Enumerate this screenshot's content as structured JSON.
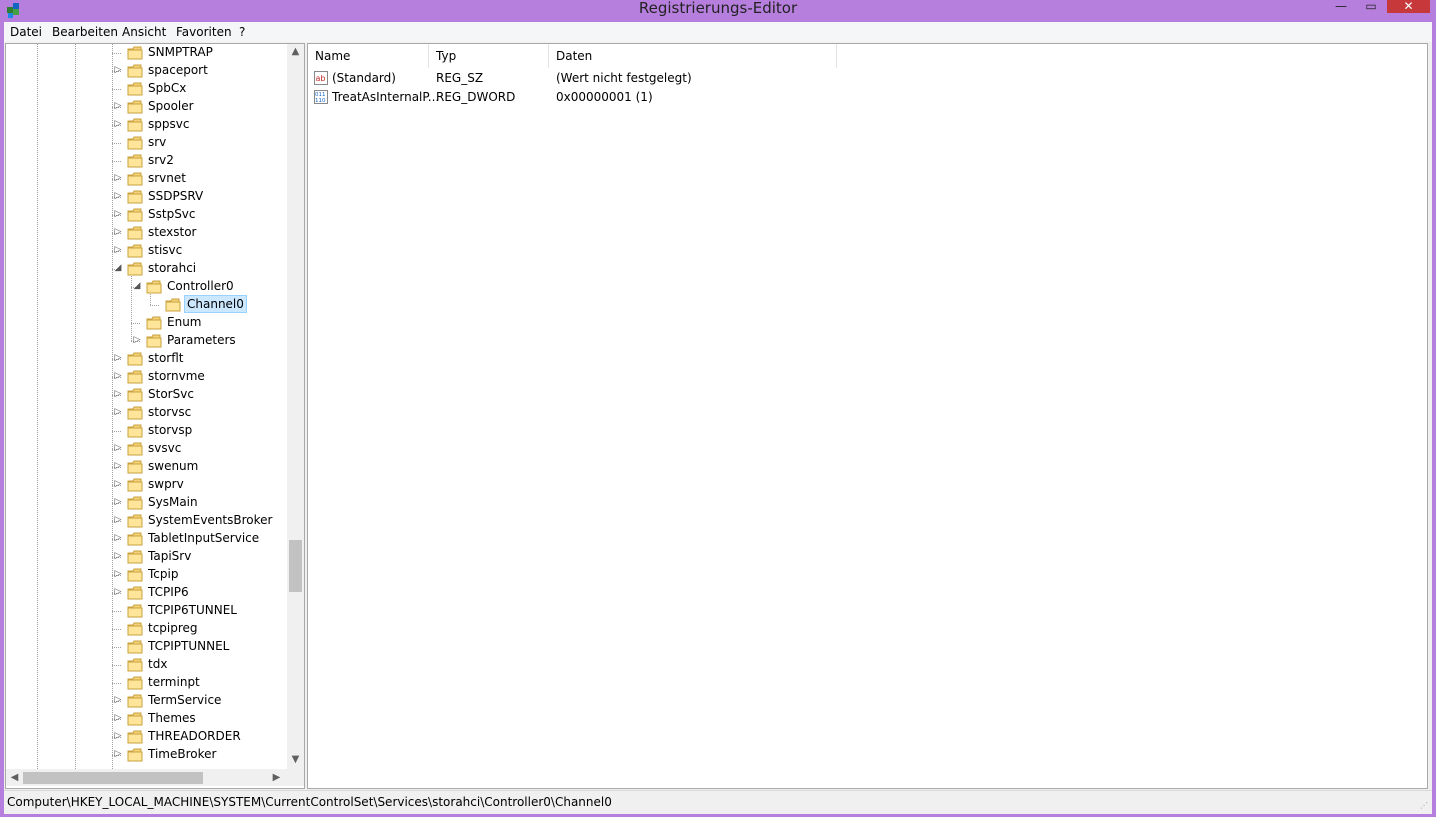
{
  "window": {
    "title": "Registrierungs-Editor",
    "icon": "registry-editor-icon",
    "minimize_glyph": "—",
    "maximize_glyph": "▭",
    "close_glyph": "✕",
    "accent_color": "#b77fdd",
    "close_color": "#c7383a"
  },
  "menu": [
    "Datei",
    "Bearbeiten",
    "Ansicht",
    "Favoriten",
    "?"
  ],
  "tree": {
    "nodes": [
      {
        "label": "SNMPTRAP",
        "level": 0,
        "expander": "none"
      },
      {
        "label": "spaceport",
        "level": 0,
        "expander": "collapsed"
      },
      {
        "label": "SpbCx",
        "level": 0,
        "expander": "none"
      },
      {
        "label": "Spooler",
        "level": 0,
        "expander": "collapsed"
      },
      {
        "label": "sppsvc",
        "level": 0,
        "expander": "collapsed"
      },
      {
        "label": "srv",
        "level": 0,
        "expander": "none"
      },
      {
        "label": "srv2",
        "level": 0,
        "expander": "none"
      },
      {
        "label": "srvnet",
        "level": 0,
        "expander": "collapsed"
      },
      {
        "label": "SSDPSRV",
        "level": 0,
        "expander": "collapsed"
      },
      {
        "label": "SstpSvc",
        "level": 0,
        "expander": "collapsed"
      },
      {
        "label": "stexstor",
        "level": 0,
        "expander": "collapsed"
      },
      {
        "label": "stisvc",
        "level": 0,
        "expander": "collapsed"
      },
      {
        "label": "storahci",
        "level": 0,
        "expander": "expanded"
      },
      {
        "label": "Controller0",
        "level": 1,
        "expander": "expanded"
      },
      {
        "label": "Channel0",
        "level": 2,
        "expander": "none",
        "selected": true
      },
      {
        "label": "Enum",
        "level": 1,
        "expander": "none"
      },
      {
        "label": "Parameters",
        "level": 1,
        "expander": "collapsed"
      },
      {
        "label": "storflt",
        "level": 0,
        "expander": "collapsed"
      },
      {
        "label": "stornvme",
        "level": 0,
        "expander": "collapsed"
      },
      {
        "label": "StorSvc",
        "level": 0,
        "expander": "collapsed"
      },
      {
        "label": "storvsc",
        "level": 0,
        "expander": "collapsed"
      },
      {
        "label": "storvsp",
        "level": 0,
        "expander": "none"
      },
      {
        "label": "svsvc",
        "level": 0,
        "expander": "collapsed"
      },
      {
        "label": "swenum",
        "level": 0,
        "expander": "collapsed"
      },
      {
        "label": "swprv",
        "level": 0,
        "expander": "collapsed"
      },
      {
        "label": "SysMain",
        "level": 0,
        "expander": "collapsed"
      },
      {
        "label": "SystemEventsBroker",
        "level": 0,
        "expander": "collapsed"
      },
      {
        "label": "TabletInputService",
        "level": 0,
        "expander": "collapsed"
      },
      {
        "label": "TapiSrv",
        "level": 0,
        "expander": "collapsed"
      },
      {
        "label": "Tcpip",
        "level": 0,
        "expander": "collapsed"
      },
      {
        "label": "TCPIP6",
        "level": 0,
        "expander": "collapsed"
      },
      {
        "label": "TCPIP6TUNNEL",
        "level": 0,
        "expander": "none"
      },
      {
        "label": "tcpipreg",
        "level": 0,
        "expander": "none"
      },
      {
        "label": "TCPIPTUNNEL",
        "level": 0,
        "expander": "none"
      },
      {
        "label": "tdx",
        "level": 0,
        "expander": "none"
      },
      {
        "label": "terminpt",
        "level": 0,
        "expander": "none"
      },
      {
        "label": "TermService",
        "level": 0,
        "expander": "collapsed"
      },
      {
        "label": "Themes",
        "level": 0,
        "expander": "collapsed"
      },
      {
        "label": "THREADORDER",
        "level": 0,
        "expander": "collapsed"
      },
      {
        "label": "TimeBroker",
        "level": 0,
        "expander": "collapsed"
      }
    ],
    "scroll_position": 0.72
  },
  "scroll_glyphs": {
    "up": "▲",
    "down": "▼",
    "left": "◀",
    "right": "▶"
  },
  "values_list": {
    "columns": [
      "Name",
      "Typ",
      "Daten"
    ],
    "rows": [
      {
        "name": "(Standard)",
        "type": "REG_SZ",
        "data": "(Wert nicht festgelegt)",
        "icon": "string-value-icon"
      },
      {
        "name": "TreatAsInternalP...",
        "type": "REG_DWORD",
        "data": "0x00000001 (1)",
        "icon": "binary-value-icon"
      }
    ]
  },
  "status": {
    "path": "Computer\\HKEY_LOCAL_MACHINE\\SYSTEM\\CurrentControlSet\\Services\\storahci\\Controller0\\Channel0"
  }
}
